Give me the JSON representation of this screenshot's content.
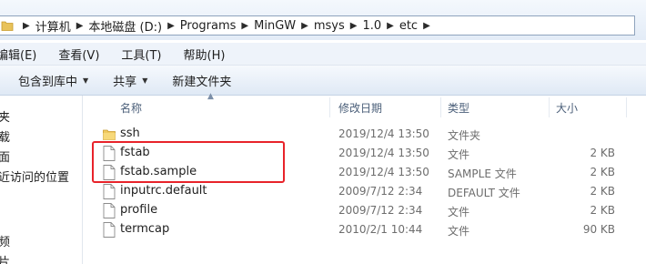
{
  "address": {
    "crumbs": [
      "计算机",
      "本地磁盘 (D:)",
      "Programs",
      "MinGW",
      "msys",
      "1.0",
      "etc"
    ]
  },
  "menu": [
    "编辑(E)",
    "查看(V)",
    "工具(T)",
    "帮助(H)"
  ],
  "toolbar": {
    "include_library": "包含到库中",
    "share": "共享",
    "new_folder": "新建文件夹"
  },
  "nav": [
    "夹",
    "载",
    "面",
    "近访问的位置",
    "频",
    "片"
  ],
  "columns": {
    "name": "名称",
    "date": "修改日期",
    "type": "类型",
    "size": "大小"
  },
  "files": [
    {
      "name": "ssh",
      "date": "2019/12/4 13:50",
      "type": "文件夹",
      "size": "",
      "icon": "folder-icon"
    },
    {
      "name": "fstab",
      "date": "2019/12/4 13:50",
      "type": "文件",
      "size": "2 KB",
      "icon": "file-icon"
    },
    {
      "name": "fstab.sample",
      "date": "2019/12/4 13:50",
      "type": "SAMPLE 文件",
      "size": "2 KB",
      "icon": "file-icon"
    },
    {
      "name": "inputrc.default",
      "date": "2009/7/12 2:34",
      "type": "DEFAULT 文件",
      "size": "2 KB",
      "icon": "file-icon"
    },
    {
      "name": "profile",
      "date": "2009/7/12 2:34",
      "type": "文件",
      "size": "2 KB",
      "icon": "file-icon"
    },
    {
      "name": "termcap",
      "date": "2010/2/1 10:44",
      "type": "文件",
      "size": "90 KB",
      "icon": "file-icon"
    }
  ],
  "highlight_color": "#e8232a"
}
